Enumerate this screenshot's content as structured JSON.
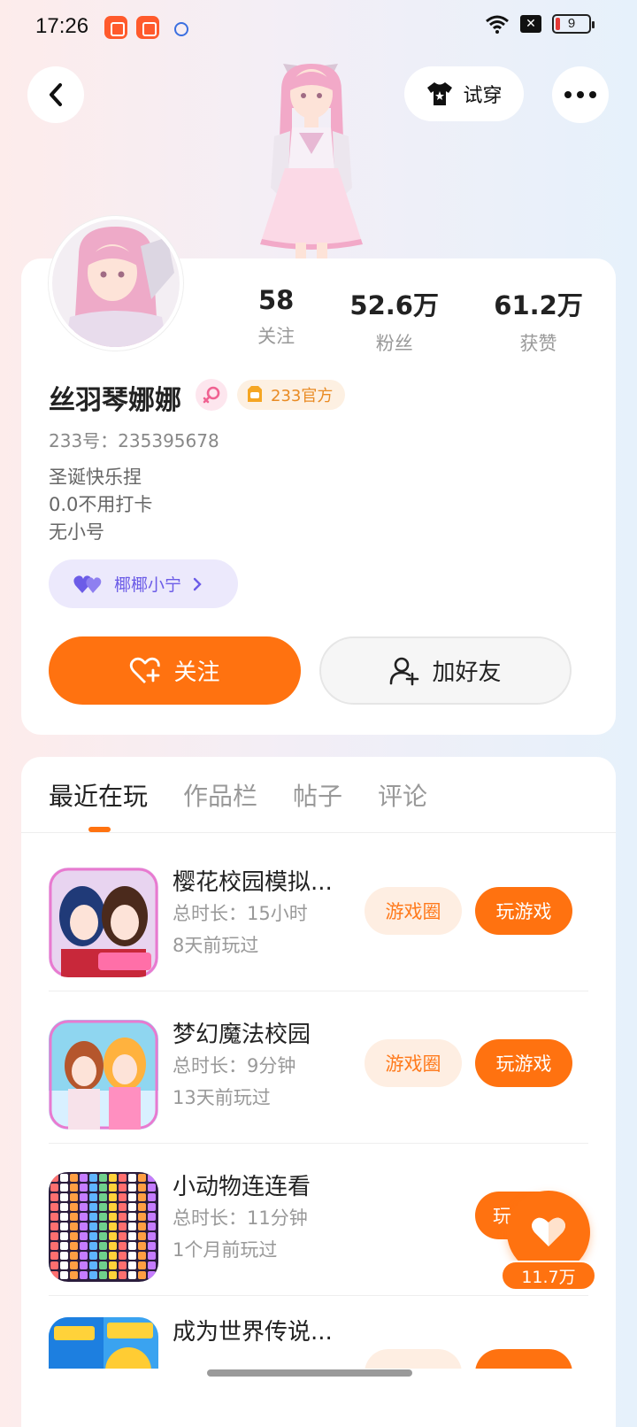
{
  "status_bar": {
    "time": "17:26",
    "battery": "9"
  },
  "header": {
    "tryon_label": "试穿"
  },
  "profile": {
    "stats": [
      {
        "value": "58",
        "label": "关注"
      },
      {
        "value": "52.6万",
        "label": "粉丝"
      },
      {
        "value": "61.2万",
        "label": "获赞"
      }
    ],
    "username": "丝羽琴娜娜",
    "official_badge": "233官方",
    "uid": "233号：235395678",
    "bio": [
      "圣诞快乐捏",
      "0.0不用打卡",
      "无小号"
    ],
    "cp_name": "椰椰小宁",
    "follow_label": "关注",
    "add_friend_label": "加好友"
  },
  "tabs": [
    {
      "label": "最近在玩",
      "active": true
    },
    {
      "label": "作品栏",
      "active": false
    },
    {
      "label": "帖子",
      "active": false
    },
    {
      "label": "评论",
      "active": false
    }
  ],
  "games": [
    {
      "name": "樱花校园模拟...",
      "duration": "总时长：15小时",
      "last_played": "8天前玩过",
      "circle_label": "游戏圈",
      "play_label": "玩游戏"
    },
    {
      "name": "梦幻魔法校园",
      "duration": "总时长：9分钟",
      "last_played": "13天前玩过",
      "circle_label": "游戏圈",
      "play_label": "玩游戏"
    },
    {
      "name": "小动物连连看",
      "duration": "总时长：11分钟",
      "last_played": "1个月前玩过",
      "circle_label": "",
      "play_label": "玩"
    },
    {
      "name": "成为世界传说...",
      "duration": "",
      "last_played": "",
      "circle_label": "",
      "play_label": ""
    }
  ],
  "like_fab": {
    "count": "11.7万"
  },
  "colors": {
    "accent": "#ff7210",
    "badge": "#e98b24",
    "cp": "#6c5ce7"
  }
}
